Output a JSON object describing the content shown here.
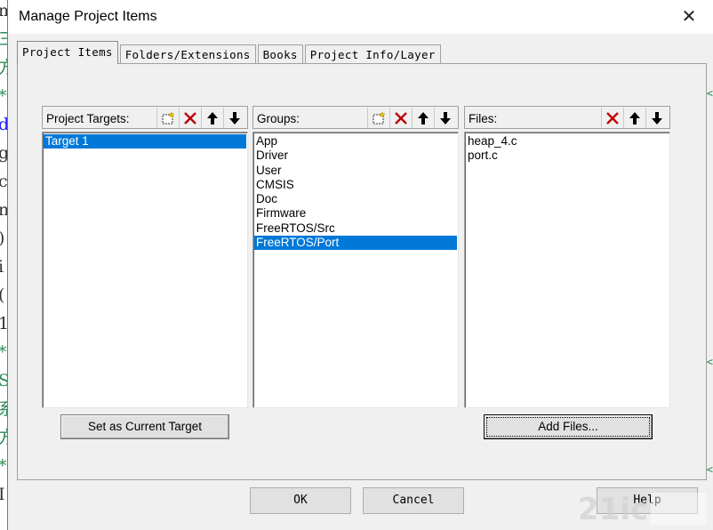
{
  "window": {
    "title": "Manage Project Items",
    "close_glyph": "✕"
  },
  "tabs": [
    {
      "label": "Project Items",
      "active": true
    },
    {
      "label": "Folders/Extensions",
      "active": false
    },
    {
      "label": "Books",
      "active": false
    },
    {
      "label": "Project Info/Layer",
      "active": false
    }
  ],
  "targets": {
    "label": "Project Targets:",
    "items": [
      "Target 1"
    ],
    "selected": 0
  },
  "groups": {
    "label": "Groups:",
    "items": [
      "App",
      "Driver",
      "User",
      "CMSIS",
      "Doc",
      "Firmware",
      "FreeRTOS/Src",
      "FreeRTOS/Port"
    ],
    "selected": 7
  },
  "files": {
    "label": "Files:",
    "items": [
      "heap_4.c",
      "port.c"
    ]
  },
  "buttons": {
    "set_current_target": "Set as Current Target",
    "add_files": "Add Files...",
    "ok": "OK",
    "cancel": "Cancel",
    "help": "Help"
  },
  "icons": {
    "new": "new-item-icon",
    "delete": "delete-icon",
    "up": "move-up-icon",
    "down": "move-down-icon"
  },
  "colors": {
    "selection": "#0078d7",
    "delete_red": "#c00000",
    "dialog_bg": "#f0f0f0"
  },
  "background_editor": {
    "left_chars": [
      "m",
      "三",
      "方",
      "*",
      "d",
      "g",
      "c",
      "n",
      ")",
      "i",
      "(",
      "1",
      "*",
      "S",
      "系",
      "方",
      "*",
      "I"
    ],
    "right_chars": [
      "<",
      "<",
      "<"
    ]
  }
}
